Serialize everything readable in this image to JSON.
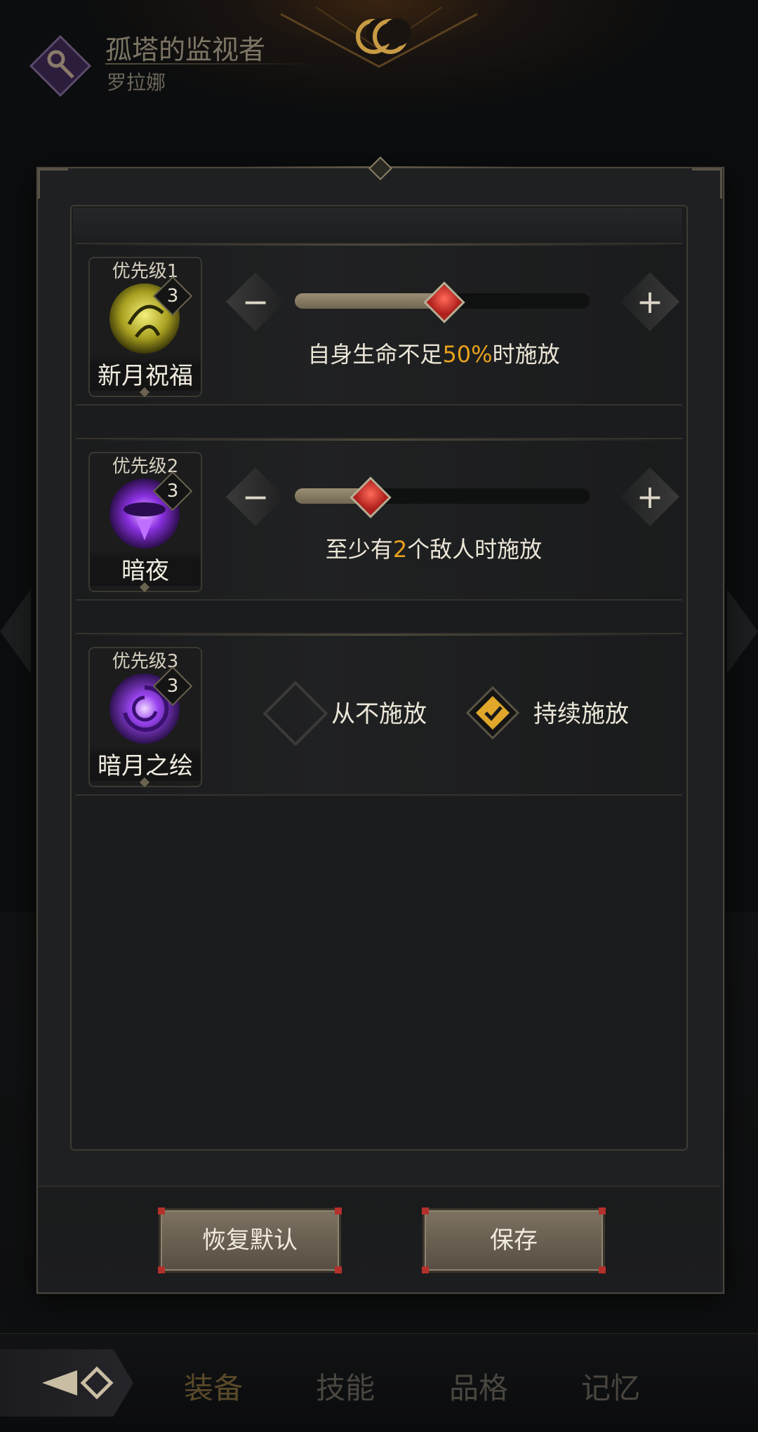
{
  "character": {
    "title": "孤塔的监视者",
    "name": "罗拉娜"
  },
  "skills": [
    {
      "priority": "优先级1",
      "name": "新月祝福",
      "level": "3",
      "minus": "−",
      "plus": "+",
      "slider_fraction": 0.5,
      "desc_prefix": "自身生命不足",
      "desc_value": "50%",
      "desc_suffix": "时施放"
    },
    {
      "priority": "优先级2",
      "name": "暗夜",
      "level": "3",
      "minus": "−",
      "plus": "+",
      "slider_fraction": 0.25,
      "desc_prefix": "至少有",
      "desc_value": "2",
      "desc_suffix": "个敌人时施放"
    },
    {
      "priority": "优先级3",
      "name": "暗月之绘",
      "level": "3",
      "option_never": "从不施放",
      "option_continuous": "持续施放",
      "selected": "option_continuous"
    }
  ],
  "buttons": {
    "reset": "恢复默认",
    "save": "保存"
  },
  "tabs": [
    "装备",
    "技能",
    "品格",
    "记忆"
  ],
  "colors": {
    "highlight": "#e8a11c",
    "check": "#e0a72a",
    "thumb": "#c8302a"
  }
}
